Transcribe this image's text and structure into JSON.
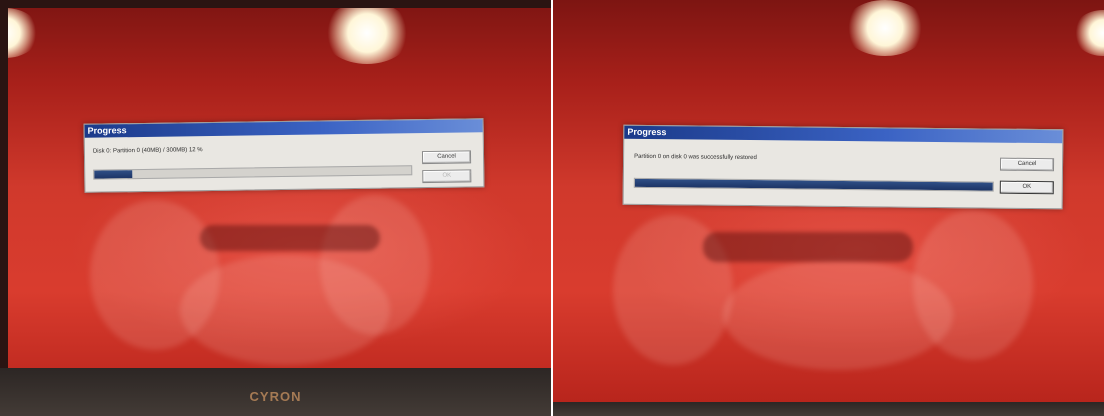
{
  "left_screen": {
    "dialog": {
      "title": "Progress",
      "message": "Disk 0: Partition 0 (40MB) / 300MB) 12 %",
      "cancel_label": "Cancel",
      "ok_label": "OK",
      "progress_fraction": 0.12
    },
    "monitor_brand": "CYRON"
  },
  "right_screen": {
    "dialog": {
      "title": "Progress",
      "message": "Partition 0 on disk 0 was successfully restored",
      "cancel_label": "Cancel",
      "ok_label": "OK",
      "progress_fraction": 1.0
    }
  },
  "colors": {
    "screen_red": "#d0392c",
    "titlebar_blue": "#1b3a8a",
    "progress_blue": "#1c3466"
  }
}
